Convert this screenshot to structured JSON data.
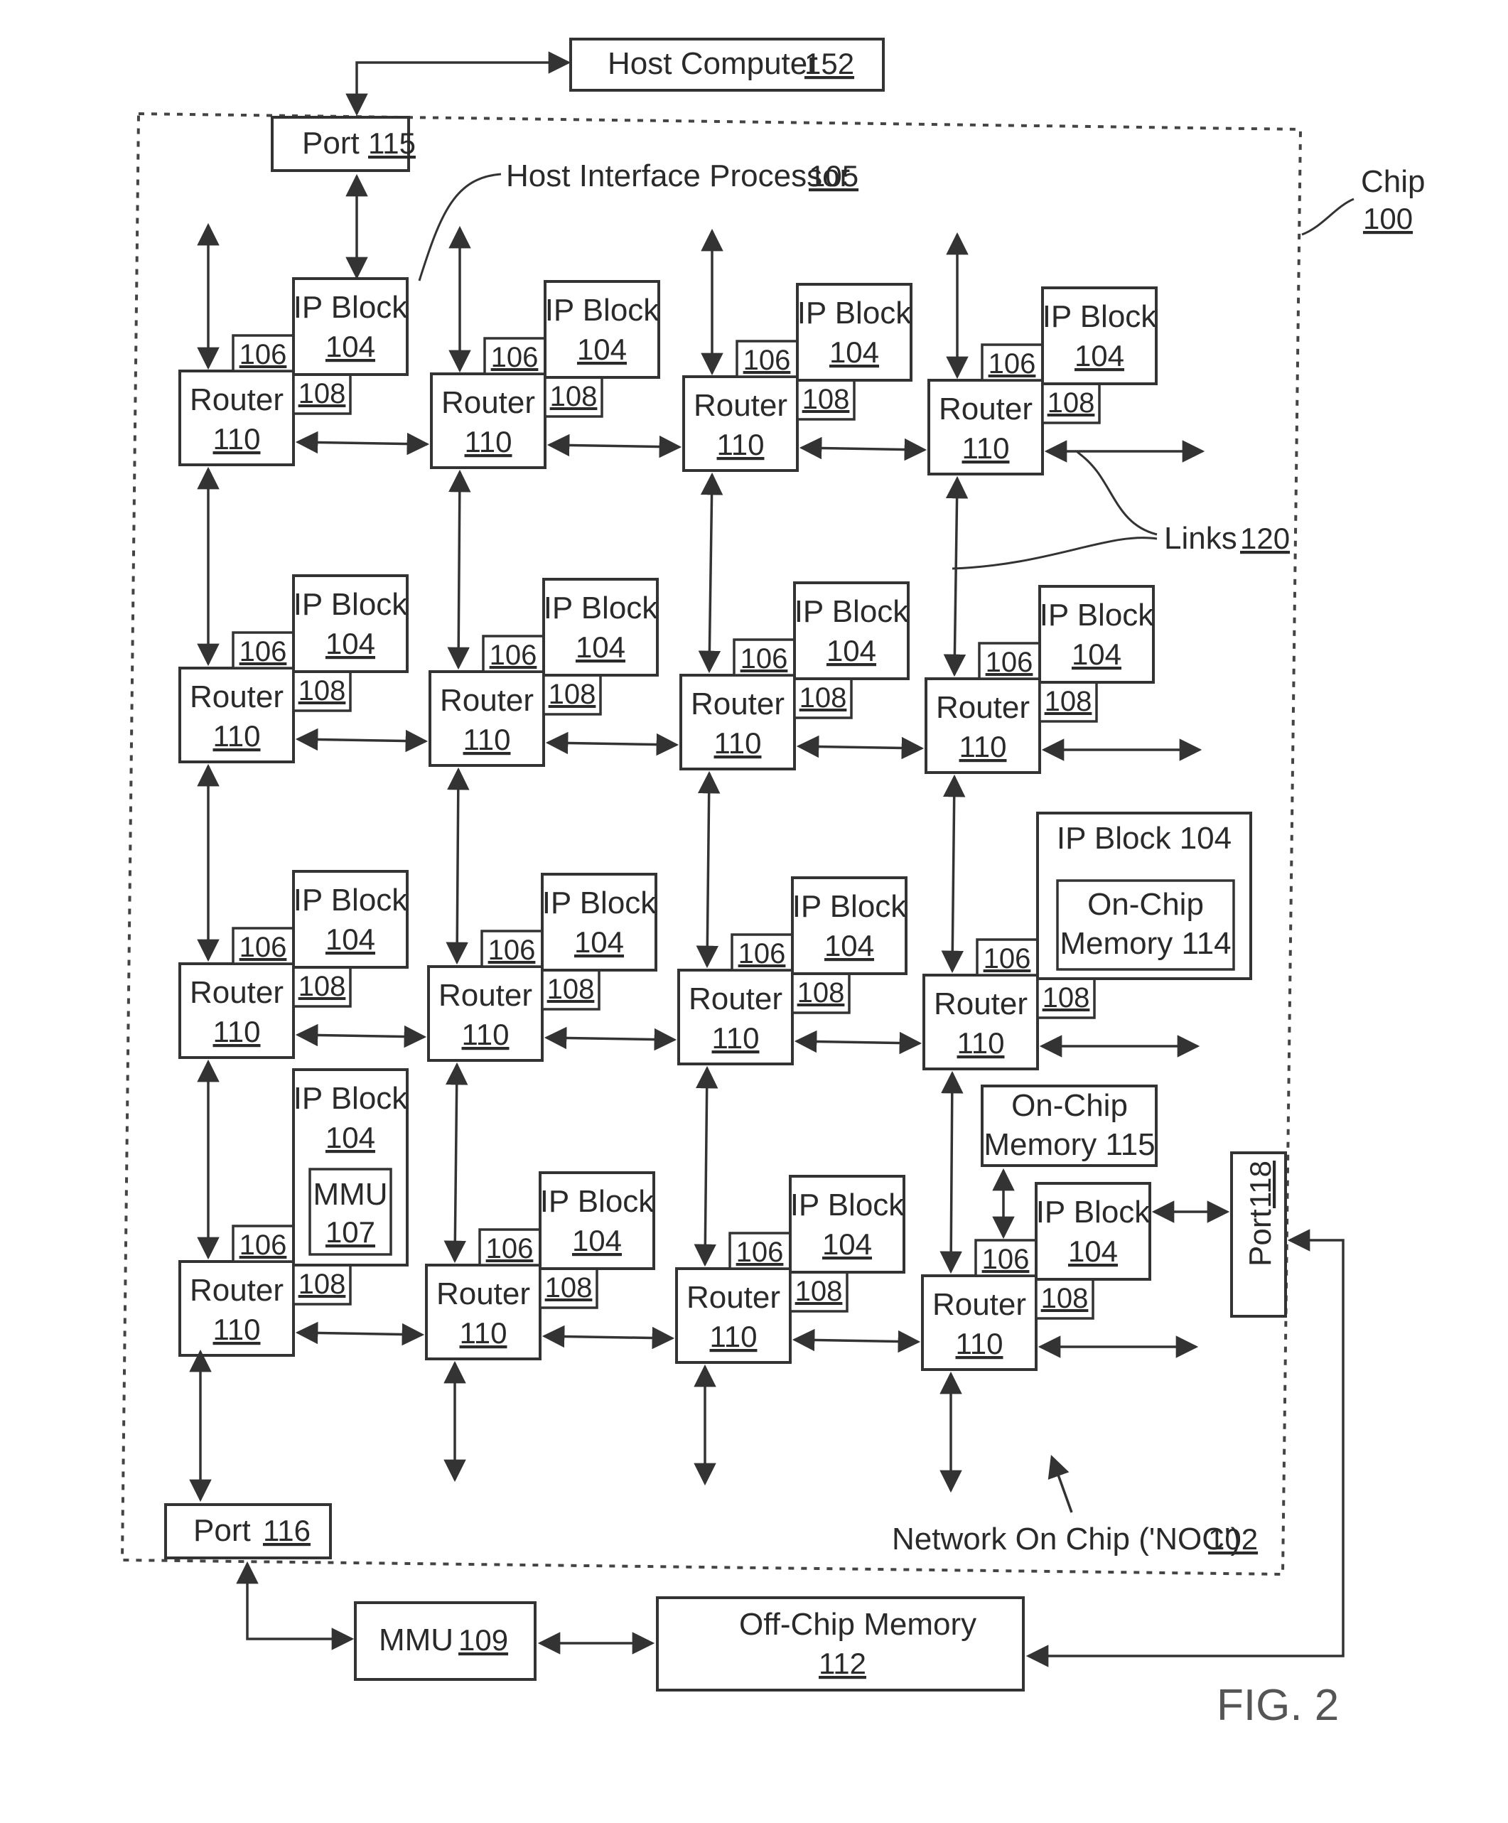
{
  "figure": {
    "label": "FIG. 2",
    "chip": {
      "name": "Chip",
      "ref": "100"
    },
    "noc": {
      "name": "Network On Chip ('NOC')",
      "ref": "102"
    },
    "host_computer": {
      "name": "Host Computer",
      "ref": "152"
    },
    "host_interface_processor": {
      "name": "Host Interface Processor",
      "ref": "105"
    },
    "links": {
      "name": "Links",
      "ref": "120"
    },
    "port_115": {
      "name": "Port",
      "ref": "115"
    },
    "port_116": {
      "name": "Port",
      "ref": "116"
    },
    "port_118": {
      "name": "Port",
      "ref": "118"
    },
    "mmu_109": {
      "name": "MMU",
      "ref": "109"
    },
    "off_chip_memory": {
      "name": "Off-Chip Memory",
      "ref": "112"
    },
    "on_chip_memory_114": {
      "line1": "On-Chip",
      "line2": "Memory",
      "ref": "114"
    },
    "on_chip_memory_115": {
      "line1": "On-Chip",
      "line2": "Memory",
      "ref": "115"
    },
    "mmu_107": {
      "name": "MMU",
      "ref": "107"
    },
    "router": {
      "name": "Router",
      "ref": "110"
    },
    "ip_block": {
      "name": "IP Block",
      "ref": "104"
    },
    "memory_comm_controller_ref": "106",
    "network_interface_controller_ref": "108",
    "grid": {
      "rows": 4,
      "cols": 4
    }
  }
}
